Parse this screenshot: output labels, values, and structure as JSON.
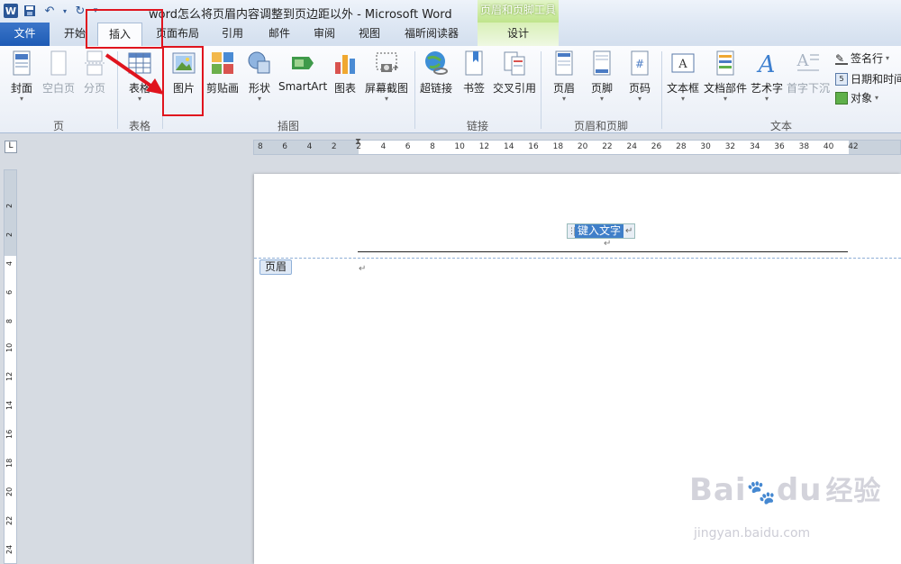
{
  "app": {
    "title": "word怎么将页眉内容调整到页边距以外 - Microsoft Word",
    "context_group_title": "页眉和页脚工具"
  },
  "tabs": [
    {
      "label": "文件",
      "active": false
    },
    {
      "label": "开始",
      "active": false
    },
    {
      "label": "插入",
      "active": true
    },
    {
      "label": "页面布局",
      "active": false
    },
    {
      "label": "引用",
      "active": false
    },
    {
      "label": "邮件",
      "active": false
    },
    {
      "label": "审阅",
      "active": false
    },
    {
      "label": "视图",
      "active": false
    },
    {
      "label": "福昕阅读器",
      "active": false
    },
    {
      "label": "设计",
      "active": false
    }
  ],
  "ribbon": {
    "buttons": [
      {
        "label": "封面",
        "icon": "cover-page-icon"
      },
      {
        "label": "空白页",
        "icon": "blank-page-icon"
      },
      {
        "label": "分页",
        "icon": "page-break-icon"
      },
      {
        "label": "表格",
        "icon": "table-icon"
      },
      {
        "label": "图片",
        "icon": "picture-icon"
      },
      {
        "label": "剪贴画",
        "icon": "clip-art-icon"
      },
      {
        "label": "形状",
        "icon": "shapes-icon"
      },
      {
        "label": "SmartArt",
        "icon": "smartart-icon"
      },
      {
        "label": "图表",
        "icon": "chart-icon"
      },
      {
        "label": "屏幕截图",
        "icon": "screenshot-icon"
      },
      {
        "label": "超链接",
        "icon": "hyperlink-icon"
      },
      {
        "label": "书签",
        "icon": "bookmark-icon"
      },
      {
        "label": "交叉引用",
        "icon": "cross-reference-icon"
      },
      {
        "label": "页眉",
        "icon": "header-icon"
      },
      {
        "label": "页脚",
        "icon": "footer-icon"
      },
      {
        "label": "页码",
        "icon": "page-number-icon"
      },
      {
        "label": "文本框",
        "icon": "text-box-icon"
      },
      {
        "label": "文档部件",
        "icon": "quick-parts-icon"
      },
      {
        "label": "艺术字",
        "icon": "wordart-icon"
      },
      {
        "label": "首字下沉",
        "icon": "drop-cap-icon"
      }
    ],
    "small_buttons": [
      {
        "label": "签名行",
        "icon": "signature-line-icon"
      },
      {
        "label": "日期和时间",
        "icon": "date-time-icon"
      },
      {
        "label": "对象",
        "icon": "object-icon"
      }
    ],
    "groups": [
      "页",
      "表格",
      "插图",
      "链接",
      "页眉和页脚",
      "文本"
    ]
  },
  "ruler": {
    "ticks": [
      "8",
      "6",
      "4",
      "2",
      "2",
      "4",
      "6",
      "8",
      "10",
      "12",
      "14",
      "16",
      "18",
      "20",
      "22",
      "24",
      "26",
      "28",
      "30",
      "32",
      "34",
      "36",
      "38",
      "40",
      "42"
    ],
    "corner": "L"
  },
  "vruler": {
    "ticks": [
      "2",
      "2",
      "4",
      "6",
      "8",
      "10",
      "12",
      "14",
      "16",
      "18",
      "20",
      "22",
      "24"
    ]
  },
  "document": {
    "field_text": "键入文字",
    "header_tag": "页眉"
  },
  "watermark": {
    "brand": "Bai",
    "brand2": "du",
    "cn": "经验",
    "url": "jingyan.baidu.com"
  },
  "colors": {
    "file_tab": "#1e5bb5",
    "highlight_box": "#e0141e",
    "context_tab": "#bfe48b"
  }
}
